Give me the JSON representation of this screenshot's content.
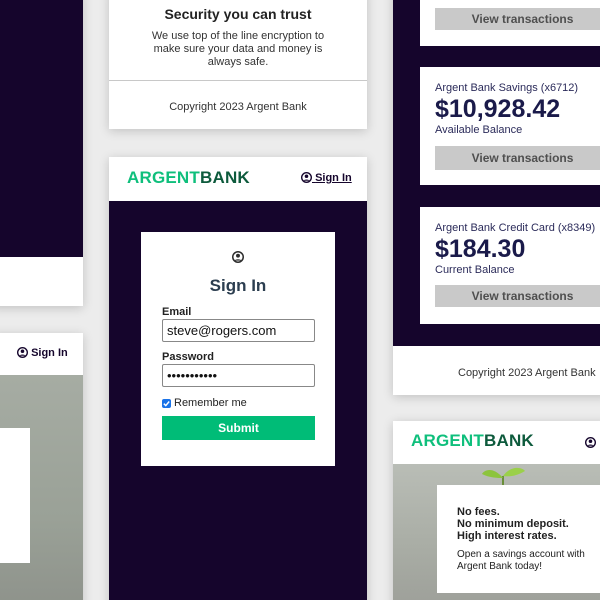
{
  "security": {
    "heading": "Security you can trust",
    "body": "We use top of the line encryption to make sure your data and money is always safe."
  },
  "footer": {
    "copyright": "Copyright 2023 Argent Bank"
  },
  "brand": {
    "part1": "ARGENT",
    "part2": "BANK"
  },
  "nav": {
    "signin_label": "Sign In"
  },
  "login": {
    "title": "Sign In",
    "email_label": "Email",
    "email_value": "steve@rogers.com",
    "password_label": "Password",
    "password_value": "•••••••••••",
    "remember_label": "Remember me",
    "submit_label": "Submit"
  },
  "accounts": [
    {
      "name": "",
      "amount": "",
      "sub": "",
      "button": "View transactions"
    },
    {
      "name": "Argent Bank Savings (x6712)",
      "amount": "$10,928.42",
      "sub": "Available Balance",
      "button": "View transactions"
    },
    {
      "name": "Argent Bank Credit Card (x8349)",
      "amount": "$184.30",
      "sub": "Current Balance",
      "button": "View transactions"
    }
  ],
  "promo": {
    "line1": "No fees.",
    "line2": "No minimum deposit.",
    "line3": "High interest rates.",
    "body": "Open a savings account with Argent Bank today!"
  },
  "colors": {
    "navy": "#15052c",
    "green": "#00bc77",
    "logo_light": "#0fbf7c",
    "logo_dark": "#0d5a3c"
  }
}
